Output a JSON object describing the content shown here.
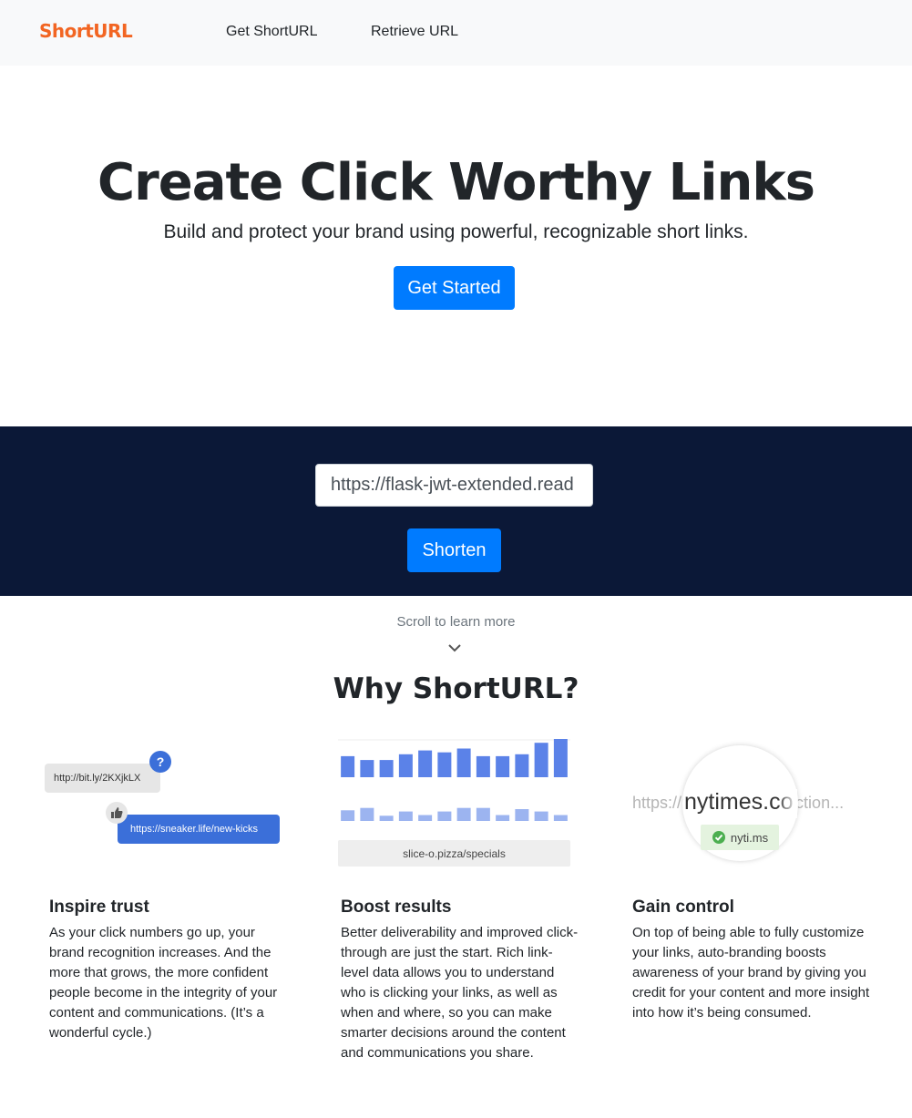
{
  "navbar": {
    "brand": "ShortURL",
    "links": [
      "Get ShortURL",
      "Retrieve URL"
    ],
    "brand_color": "#f26522"
  },
  "hero": {
    "title": "Create Click Worthy Links",
    "subtitle": "Build and protect your brand using powerful, recognizable short links.",
    "cta_label": "Get Started"
  },
  "shorten": {
    "input_value": "https://flask-jwt-extended.read",
    "button_label": "Shorten",
    "band_color": "#0b1837",
    "accent": "#007bff"
  },
  "scroll_hint": "Scroll to learn more",
  "why": {
    "title": "Why ShortURL?",
    "features": [
      {
        "title": "Inspire trust",
        "text": "As your click numbers go up, your brand recognition increases. And the more that grows, the more confident people become in the integrity of your content and communications. (It’s a wonderful cycle.)",
        "illustration": {
          "short_link": "http://bit.ly/2KXjkLX",
          "branded_link": "https://sneaker.life/new-kicks",
          "question_mark": "?"
        }
      },
      {
        "title": "Boost results",
        "text": "Better deliverability and improved click-through are just the start. Rich link-level data allows you to understand who is clicking your links, as well as when and where, so you can make smarter decisions around the content and communications you share.",
        "illustration": {
          "link_label": "slice-o.pizza/specials",
          "bars_top": [
            0.55,
            0.45,
            0.45,
            0.6,
            0.7,
            0.65,
            0.75,
            0.55,
            0.55,
            0.6,
            0.9,
            1.0
          ],
          "bars_bottom": [
            0.45,
            0.55,
            0.22,
            0.4,
            0.25,
            0.4,
            0.55,
            0.55,
            0.25,
            0.5,
            0.4,
            0.25
          ]
        }
      },
      {
        "title": "Gain control",
        "text": "On top of being able to fully customize your links, auto-branding boosts awareness of your brand by giving you credit for your content and more insight into how it’s being consumed.",
        "illustration": {
          "background_url": "https://nytimes.com/section...",
          "zoom_text": "nytimes.co",
          "badge": "nyti.ms"
        }
      }
    ]
  }
}
